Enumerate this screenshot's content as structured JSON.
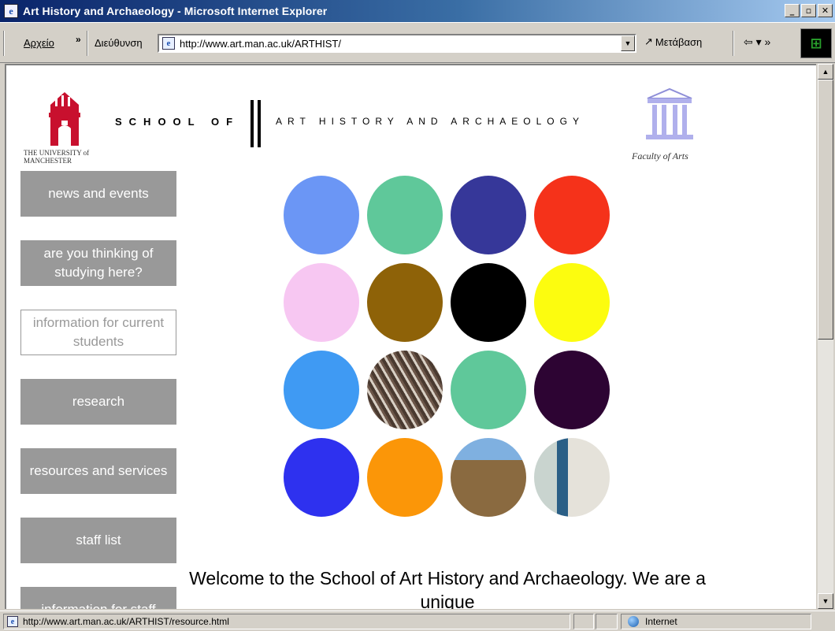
{
  "window": {
    "title": "Art History and Archaeology - Microsoft Internet Explorer",
    "min_glyph": "_",
    "max_glyph": "▫",
    "close_glyph": "✕"
  },
  "toolbar": {
    "file_menu": "Αρχείο",
    "chevron": "»",
    "address_label": "Διεύθυνση",
    "url": "http://www.art.man.ac.uk/ARTHIST/",
    "go_label": "Μετάβαση",
    "links_label": "⇦ ▾ »"
  },
  "page": {
    "university_text": "THE UNIVERSITY of MANCHESTER",
    "school_of": "SCHOOL OF",
    "subject": "ART HISTORY AND ARCHAEOLOGY",
    "faculty_text": "Faculty of Arts",
    "nav": [
      {
        "label": "news and events"
      },
      {
        "label": "are you thinking of studying here?"
      },
      {
        "label": "information for current students"
      },
      {
        "label": "research"
      },
      {
        "label": "resources and services"
      },
      {
        "label": "staff list"
      },
      {
        "label": "information for staff"
      }
    ],
    "circles": [
      "#6b96f5",
      "#5fc89a",
      "#363799",
      "#f5321a",
      "#f7c7f2",
      "#8e6208",
      "#000000",
      "#fcfc0f",
      "#3f9af3",
      "image",
      "#5fc89a",
      "#2d0433",
      "#2e31ef",
      "#fb9608",
      "image",
      "image"
    ],
    "welcome": "Welcome to the School of Art History and Archaeology. We are a unique"
  },
  "status": {
    "url": "http://www.art.man.ac.uk/ARTHIST/resource.html",
    "zone": "Internet"
  }
}
